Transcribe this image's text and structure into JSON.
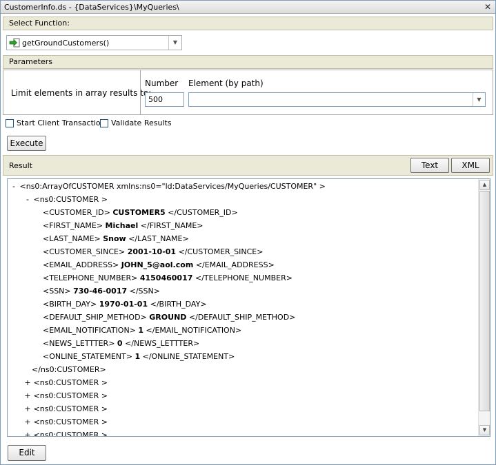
{
  "window": {
    "title": "CustomerInfo.ds - {DataServices}\\MyQueries\\",
    "close_glyph": "✕"
  },
  "function_section": {
    "header": "Select Function:",
    "selected": "getGroundCustomers()"
  },
  "parameters": {
    "header": "Parameters",
    "limit_label": "Limit elements in array results to:",
    "number_label": "Number",
    "number_value": "500",
    "element_label": "Element (by path)",
    "element_value": ""
  },
  "options": {
    "start_transaction_label": "Start Client Transaction",
    "start_transaction_checked": false,
    "validate_label": "Validate Results",
    "validate_checked": false
  },
  "buttons": {
    "execute": "Execute",
    "text": "Text",
    "xml": "XML",
    "edit": "Edit"
  },
  "result": {
    "header": "Result",
    "root_open": "<ns0:ArrayOfCUSTOMER xmlns:ns0=\"ld:DataServices/MyQueries/CUSTOMER\" >",
    "customer_open": "<ns0:CUSTOMER >",
    "customer_close": "</ns0:CUSTOMER>",
    "expand_glyph": "+",
    "collapse_glyph": "-",
    "fields": [
      {
        "tag": "CUSTOMER_ID",
        "value": "CUSTOMER5"
      },
      {
        "tag": "FIRST_NAME",
        "value": "Michael"
      },
      {
        "tag": "LAST_NAME",
        "value": "Snow"
      },
      {
        "tag": "CUSTOMER_SINCE",
        "value": "2001-10-01"
      },
      {
        "tag": "EMAIL_ADDRESS",
        "value": "JOHN_5@aol.com"
      },
      {
        "tag": "TELEPHONE_NUMBER",
        "value": "4150460017"
      },
      {
        "tag": "SSN",
        "value": "730-46-0017"
      },
      {
        "tag": "BIRTH_DAY",
        "value": "1970-01-01"
      },
      {
        "tag": "DEFAULT_SHIP_METHOD",
        "value": "GROUND"
      },
      {
        "tag": "EMAIL_NOTIFICATION",
        "value": "1"
      },
      {
        "tag": "NEWS_LETTTER",
        "value": "0"
      },
      {
        "tag": "ONLINE_STATEMENT",
        "value": "1"
      }
    ],
    "collapsed_customers": 5
  },
  "icons": {
    "function_icon": "green-arrow-into-box-icon",
    "dropdown": "chevron-down-icon",
    "scroll_up": "scroll-up-arrow-icon",
    "scroll_down": "scroll-down-arrow-icon"
  },
  "colors": {
    "section_header_bg": "#ebe9d8",
    "border_blue": "#7f9db9",
    "function_icon_green": "#2e9e2e"
  }
}
